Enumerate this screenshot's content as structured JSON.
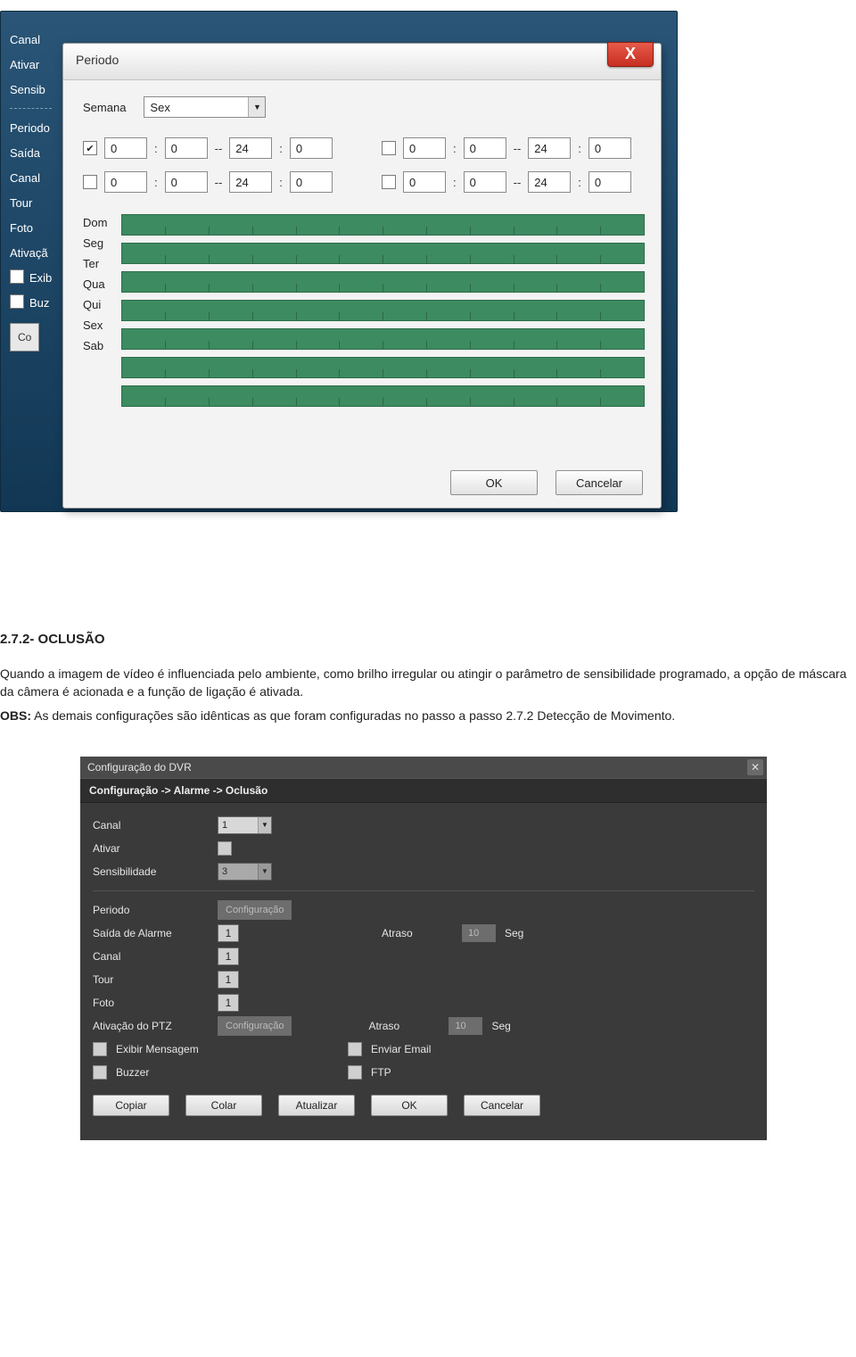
{
  "bg_window": {
    "labels": [
      "Canal",
      "Ativar",
      "Sensib",
      "Periodo",
      "Saída",
      "Canal",
      "Tour",
      "Foto",
      "Ativaçã",
      "Exib",
      "Buz",
      "Co"
    ]
  },
  "periodo_dialog": {
    "title": "Periodo",
    "close_glyph": "X",
    "semana_label": "Semana",
    "semana_value": "Sex",
    "time_rows": [
      {
        "checked": true,
        "h1": "0",
        "m1": "0",
        "h2": "24",
        "m2": "0"
      },
      {
        "checked": false,
        "h1": "0",
        "m1": "0",
        "h2": "24",
        "m2": "0"
      },
      {
        "checked": false,
        "h1": "0",
        "m1": "0",
        "h2": "24",
        "m2": "0"
      },
      {
        "checked": false,
        "h1": "0",
        "m1": "0",
        "h2": "24",
        "m2": "0"
      }
    ],
    "days": [
      "Dom",
      "Seg",
      "Ter",
      "Qua",
      "Qui",
      "Sex",
      "Sab"
    ],
    "ok_label": "OK",
    "cancel_label": "Cancelar"
  },
  "doc": {
    "heading": "2.7.2- OCLUSÃO",
    "p1": "Quando a imagem de vídeo é influenciada pelo ambiente, como brilho irregular ou atingir o parâmetro de sensibilidade programado, a opção de máscara da câmera é acionada e a função de ligação é ativada.",
    "obs_label": "OBS:",
    "p2": " As demais configurações são idênticas as que foram configuradas no passo a passo 2.7.2 Detecção de Movimento."
  },
  "dvr": {
    "window_title": "Configuração do DVR",
    "path": "Configuração -> Alarme -> Oclusão",
    "labels": {
      "canal": "Canal",
      "ativar": "Ativar",
      "sensibilidade": "Sensibilidade",
      "periodo": "Periodo",
      "saida": "Saída de Alarme",
      "canal2": "Canal",
      "tour": "Tour",
      "foto": "Foto",
      "ativacao_ptz": "Ativação do PTZ",
      "atraso": "Atraso",
      "seg": "Seg",
      "exibir": "Exibir Mensagem",
      "email": "Enviar Email",
      "buzzer": "Buzzer",
      "ftp": "FTP",
      "config_btn": "Configuração"
    },
    "values": {
      "canal": "1",
      "sensibilidade": "3",
      "saida_box": "1",
      "canal_box": "1",
      "tour_box": "1",
      "foto_box": "1",
      "atraso1": "10",
      "atraso2": "10"
    },
    "buttons": [
      "Copiar",
      "Colar",
      "Atualizar",
      "OK",
      "Cancelar"
    ]
  }
}
